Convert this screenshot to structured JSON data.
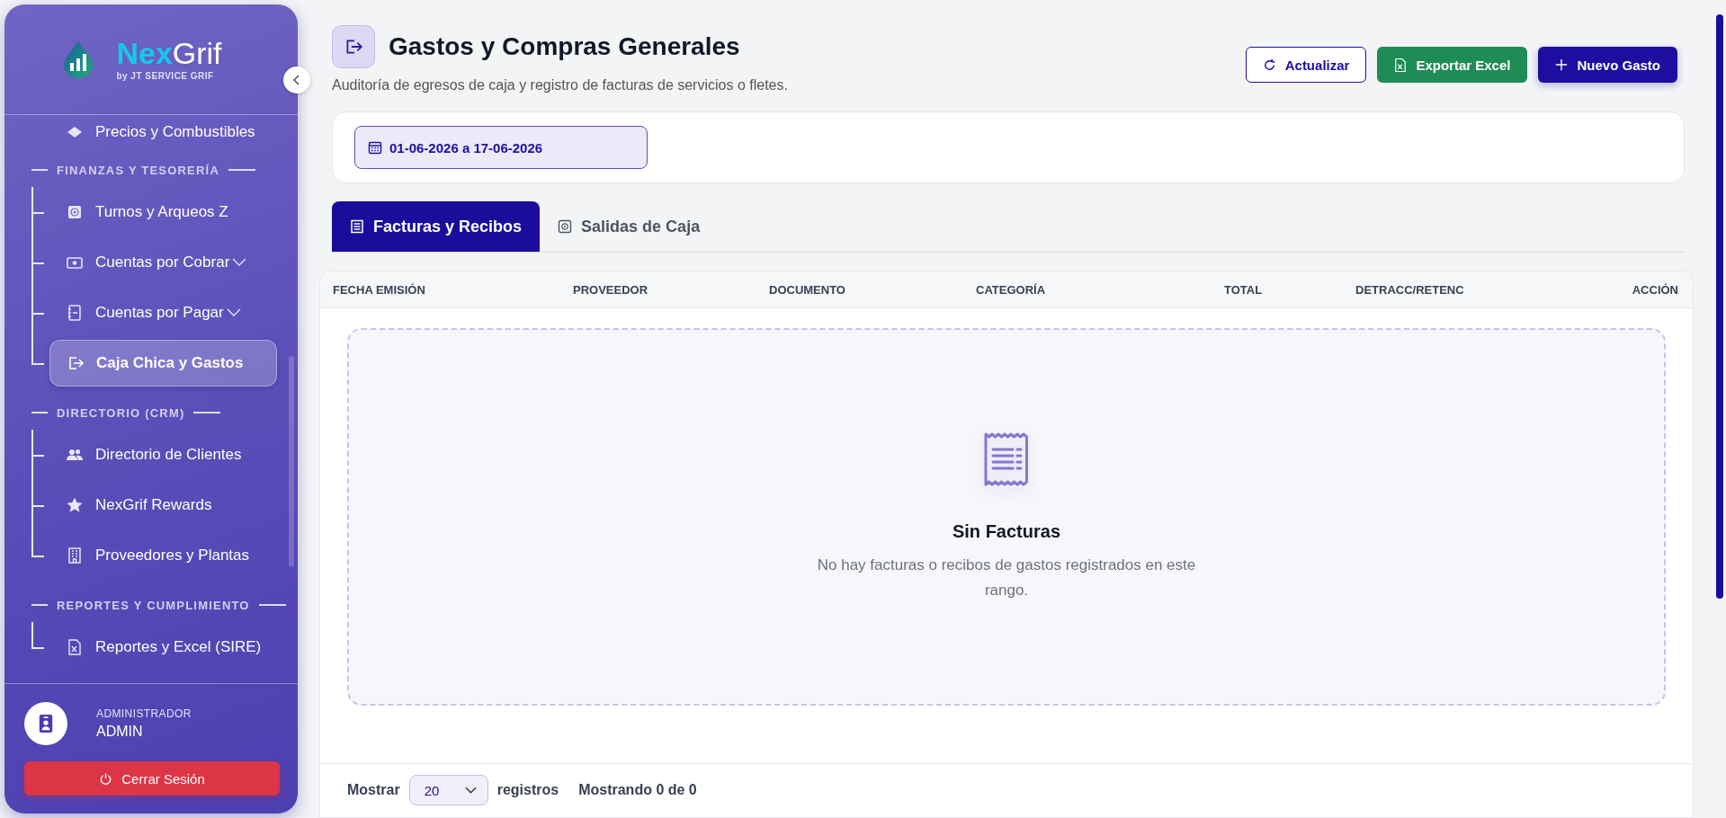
{
  "sidebar": {
    "logo": {
      "name_parts": [
        "Nex",
        "Grif"
      ],
      "tagline": "by JT SERVICE GRIF"
    },
    "sections": [
      {
        "items": [
          {
            "label": "Precios y Combustibles",
            "selected": false,
            "expandable": false
          }
        ]
      },
      {
        "title": "FINANZAS Y TESORERÍA",
        "items": [
          {
            "label": "Turnos y Arqueos Z",
            "selected": false,
            "expandable": false
          },
          {
            "label": "Cuentas por Cobrar",
            "selected": false,
            "expandable": true
          },
          {
            "label": "Cuentas por Pagar",
            "selected": false,
            "expandable": true
          },
          {
            "label": "Caja Chica y Gastos",
            "selected": true,
            "expandable": false
          }
        ]
      },
      {
        "title": "DIRECTORIO (CRM)",
        "items": [
          {
            "label": "Directorio de Clientes",
            "selected": false,
            "expandable": false
          },
          {
            "label": "NexGrif Rewards",
            "selected": false,
            "expandable": false
          },
          {
            "label": "Proveedores y Plantas",
            "selected": false,
            "expandable": false
          }
        ]
      },
      {
        "title": "REPORTES Y CUMPLIMIENTO",
        "items": [
          {
            "label": "Reportes y Excel (SIRE)",
            "selected": false,
            "expandable": false
          }
        ]
      }
    ],
    "user": {
      "role": "ADMINISTRADOR",
      "name": "ADMIN"
    },
    "logout": "Cerrar Sesión"
  },
  "header": {
    "title": "Gastos y Compras Generales",
    "subtitle": "Auditoría de egresos de caja y registro de facturas de servicios o fletes.",
    "buttons": [
      {
        "label": "Actualizar",
        "kind": "outline"
      },
      {
        "label": "Exportar Excel",
        "kind": "excel"
      },
      {
        "label": "Nuevo Gasto",
        "kind": "primary"
      }
    ]
  },
  "date_range": "01-06-2026 a 17-06-2026",
  "tabs": [
    {
      "label": "Facturas y Recibos",
      "selected": true
    },
    {
      "label": "Salidas de Caja",
      "selected": false
    }
  ],
  "table": {
    "columns": [
      "FECHA EMISIÓN",
      "PROVEEDOR",
      "DOCUMENTO",
      "CATEGORÍA",
      "TOTAL",
      "DETRACC/RETENC",
      "ACCIÓN"
    ],
    "empty": {
      "title": "Sin Facturas",
      "message": "No hay facturas o recibos de gastos registrados en este rango."
    }
  },
  "pagination": {
    "show_label": "Mostrar",
    "page_size": "20",
    "records_label": "registros",
    "summary": "Mostrando 0 de 0"
  }
}
